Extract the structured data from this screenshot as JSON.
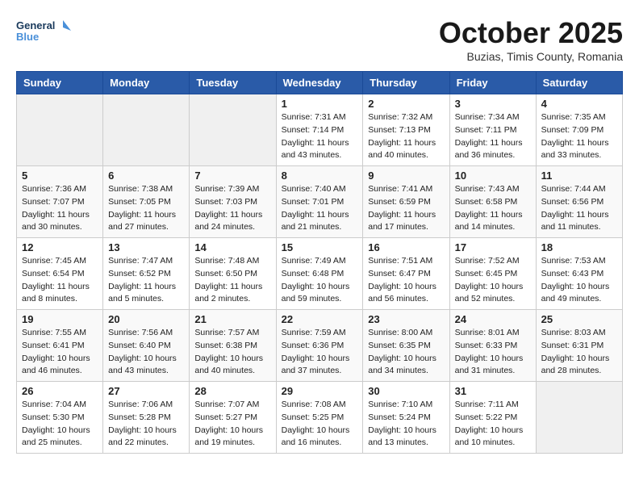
{
  "header": {
    "logo_line1": "General",
    "logo_line2": "Blue",
    "month": "October 2025",
    "location": "Buzias, Timis County, Romania"
  },
  "weekdays": [
    "Sunday",
    "Monday",
    "Tuesday",
    "Wednesday",
    "Thursday",
    "Friday",
    "Saturday"
  ],
  "weeks": [
    [
      {
        "day": "",
        "info": ""
      },
      {
        "day": "",
        "info": ""
      },
      {
        "day": "",
        "info": ""
      },
      {
        "day": "1",
        "info": "Sunrise: 7:31 AM\nSunset: 7:14 PM\nDaylight: 11 hours\nand 43 minutes."
      },
      {
        "day": "2",
        "info": "Sunrise: 7:32 AM\nSunset: 7:13 PM\nDaylight: 11 hours\nand 40 minutes."
      },
      {
        "day": "3",
        "info": "Sunrise: 7:34 AM\nSunset: 7:11 PM\nDaylight: 11 hours\nand 36 minutes."
      },
      {
        "day": "4",
        "info": "Sunrise: 7:35 AM\nSunset: 7:09 PM\nDaylight: 11 hours\nand 33 minutes."
      }
    ],
    [
      {
        "day": "5",
        "info": "Sunrise: 7:36 AM\nSunset: 7:07 PM\nDaylight: 11 hours\nand 30 minutes."
      },
      {
        "day": "6",
        "info": "Sunrise: 7:38 AM\nSunset: 7:05 PM\nDaylight: 11 hours\nand 27 minutes."
      },
      {
        "day": "7",
        "info": "Sunrise: 7:39 AM\nSunset: 7:03 PM\nDaylight: 11 hours\nand 24 minutes."
      },
      {
        "day": "8",
        "info": "Sunrise: 7:40 AM\nSunset: 7:01 PM\nDaylight: 11 hours\nand 21 minutes."
      },
      {
        "day": "9",
        "info": "Sunrise: 7:41 AM\nSunset: 6:59 PM\nDaylight: 11 hours\nand 17 minutes."
      },
      {
        "day": "10",
        "info": "Sunrise: 7:43 AM\nSunset: 6:58 PM\nDaylight: 11 hours\nand 14 minutes."
      },
      {
        "day": "11",
        "info": "Sunrise: 7:44 AM\nSunset: 6:56 PM\nDaylight: 11 hours\nand 11 minutes."
      }
    ],
    [
      {
        "day": "12",
        "info": "Sunrise: 7:45 AM\nSunset: 6:54 PM\nDaylight: 11 hours\nand 8 minutes."
      },
      {
        "day": "13",
        "info": "Sunrise: 7:47 AM\nSunset: 6:52 PM\nDaylight: 11 hours\nand 5 minutes."
      },
      {
        "day": "14",
        "info": "Sunrise: 7:48 AM\nSunset: 6:50 PM\nDaylight: 11 hours\nand 2 minutes."
      },
      {
        "day": "15",
        "info": "Sunrise: 7:49 AM\nSunset: 6:48 PM\nDaylight: 10 hours\nand 59 minutes."
      },
      {
        "day": "16",
        "info": "Sunrise: 7:51 AM\nSunset: 6:47 PM\nDaylight: 10 hours\nand 56 minutes."
      },
      {
        "day": "17",
        "info": "Sunrise: 7:52 AM\nSunset: 6:45 PM\nDaylight: 10 hours\nand 52 minutes."
      },
      {
        "day": "18",
        "info": "Sunrise: 7:53 AM\nSunset: 6:43 PM\nDaylight: 10 hours\nand 49 minutes."
      }
    ],
    [
      {
        "day": "19",
        "info": "Sunrise: 7:55 AM\nSunset: 6:41 PM\nDaylight: 10 hours\nand 46 minutes."
      },
      {
        "day": "20",
        "info": "Sunrise: 7:56 AM\nSunset: 6:40 PM\nDaylight: 10 hours\nand 43 minutes."
      },
      {
        "day": "21",
        "info": "Sunrise: 7:57 AM\nSunset: 6:38 PM\nDaylight: 10 hours\nand 40 minutes."
      },
      {
        "day": "22",
        "info": "Sunrise: 7:59 AM\nSunset: 6:36 PM\nDaylight: 10 hours\nand 37 minutes."
      },
      {
        "day": "23",
        "info": "Sunrise: 8:00 AM\nSunset: 6:35 PM\nDaylight: 10 hours\nand 34 minutes."
      },
      {
        "day": "24",
        "info": "Sunrise: 8:01 AM\nSunset: 6:33 PM\nDaylight: 10 hours\nand 31 minutes."
      },
      {
        "day": "25",
        "info": "Sunrise: 8:03 AM\nSunset: 6:31 PM\nDaylight: 10 hours\nand 28 minutes."
      }
    ],
    [
      {
        "day": "26",
        "info": "Sunrise: 7:04 AM\nSunset: 5:30 PM\nDaylight: 10 hours\nand 25 minutes."
      },
      {
        "day": "27",
        "info": "Sunrise: 7:06 AM\nSunset: 5:28 PM\nDaylight: 10 hours\nand 22 minutes."
      },
      {
        "day": "28",
        "info": "Sunrise: 7:07 AM\nSunset: 5:27 PM\nDaylight: 10 hours\nand 19 minutes."
      },
      {
        "day": "29",
        "info": "Sunrise: 7:08 AM\nSunset: 5:25 PM\nDaylight: 10 hours\nand 16 minutes."
      },
      {
        "day": "30",
        "info": "Sunrise: 7:10 AM\nSunset: 5:24 PM\nDaylight: 10 hours\nand 13 minutes."
      },
      {
        "day": "31",
        "info": "Sunrise: 7:11 AM\nSunset: 5:22 PM\nDaylight: 10 hours\nand 10 minutes."
      },
      {
        "day": "",
        "info": ""
      }
    ]
  ]
}
